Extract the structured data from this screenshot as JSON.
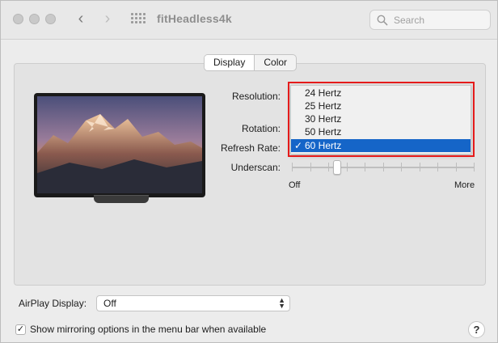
{
  "window": {
    "title": "fitHeadless4k",
    "search_placeholder": "Search"
  },
  "tabs": [
    {
      "label": "Display",
      "selected": true
    },
    {
      "label": "Color",
      "selected": false
    }
  ],
  "labels": {
    "resolution": "Resolution:",
    "rotation": "Rotation:",
    "refresh_rate": "Refresh Rate:",
    "underscan": "Underscan:"
  },
  "refresh_options": [
    {
      "label": "24 Hertz",
      "selected": false
    },
    {
      "label": "25 Hertz",
      "selected": false
    },
    {
      "label": "30 Hertz",
      "selected": false
    },
    {
      "label": "50 Hertz",
      "selected": false
    },
    {
      "label": "60 Hertz",
      "selected": true
    }
  ],
  "check_glyph": "✓",
  "underscan": {
    "min_label": "Off",
    "max_label": "More",
    "value_fraction": 0.25
  },
  "airplay": {
    "label": "AirPlay Display:",
    "value": "Off"
  },
  "mirroring": {
    "label": "Show mirroring options in the menu bar when available",
    "checked": true
  },
  "help": "?",
  "colors": {
    "highlight_border": "#e51b1b",
    "selection": "#1565c8"
  },
  "icons": {
    "back": "chevron-left-icon",
    "forward": "chevron-right-icon",
    "grid": "grid-icon",
    "search": "search-icon",
    "popup_arrows": "up-down-chevron-icon"
  }
}
